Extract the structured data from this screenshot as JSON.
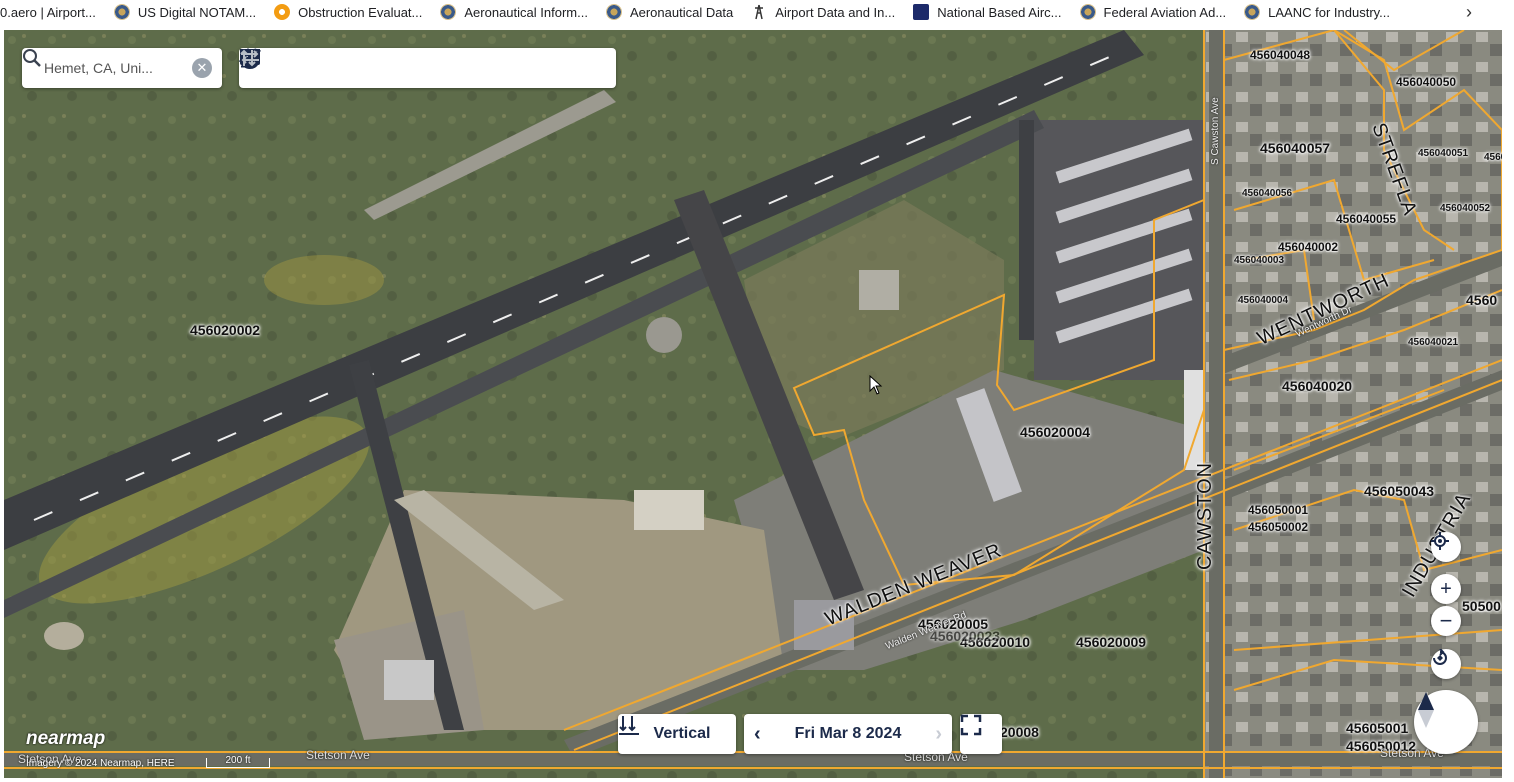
{
  "bookmarks": [
    {
      "label": "0.aero | Airport...",
      "icon": "none"
    },
    {
      "label": "US Digital NOTAM...",
      "icon": "seal"
    },
    {
      "label": "Obstruction Evaluat...",
      "icon": "orange"
    },
    {
      "label": "Aeronautical Inform...",
      "icon": "seal"
    },
    {
      "label": "Aeronautical Data",
      "icon": "seal"
    },
    {
      "label": "Airport Data and In...",
      "icon": "tower"
    },
    {
      "label": "National Based Airc...",
      "icon": "navy"
    },
    {
      "label": "Federal Aviation Ad...",
      "icon": "seal"
    },
    {
      "label": "LAANC for Industry...",
      "icon": "seal"
    }
  ],
  "search": {
    "value": "Hemet, CA, Uni...",
    "clear_label": "✕"
  },
  "tools": [
    "pin-icon",
    "camera-icon",
    "text-icon",
    "polyline-icon",
    "polygon-icon",
    "rectangle-icon",
    "circle-icon",
    "height-icon",
    "swap-icon"
  ],
  "parcels": [
    {
      "id": "p1",
      "label": "456020002"
    },
    {
      "id": "p2",
      "label": "456020004"
    },
    {
      "id": "p3",
      "label": "456040048"
    },
    {
      "id": "p4",
      "label": "456040050"
    },
    {
      "id": "p5",
      "label": "456040057"
    },
    {
      "id": "p6",
      "label": "456040051"
    },
    {
      "id": "p7",
      "label": "456040056"
    },
    {
      "id": "p8",
      "label": "456040055"
    },
    {
      "id": "p9",
      "label": "456040052"
    },
    {
      "id": "p10",
      "label": "456040002"
    },
    {
      "id": "p11",
      "label": "456040003"
    },
    {
      "id": "p12",
      "label": "456040004"
    },
    {
      "id": "p13",
      "label": "456040021"
    },
    {
      "id": "p14",
      "label": "456040020"
    },
    {
      "id": "p15",
      "label": "456050043"
    },
    {
      "id": "p16",
      "label": "456050001"
    },
    {
      "id": "p17",
      "label": "456050002"
    },
    {
      "id": "p18",
      "label": "456020005"
    },
    {
      "id": "p19",
      "label": "456020010"
    },
    {
      "id": "p20",
      "label": "456020009"
    },
    {
      "id": "p21",
      "label": "20008"
    },
    {
      "id": "p22",
      "label": "45605001"
    },
    {
      "id": "p23",
      "label": "4560"
    },
    {
      "id": "p24",
      "label": "4560"
    },
    {
      "id": "p25",
      "label": "50500"
    },
    {
      "id": "p26",
      "label": "456050012"
    },
    {
      "id": "p27",
      "label": "456020023"
    }
  ],
  "streets": [
    {
      "label": "WALDEN WEAVER"
    },
    {
      "label": "CAWSTON"
    },
    {
      "label": "WENTWORTH"
    },
    {
      "label": "STREFLA"
    },
    {
      "label": "INDUSTRIA"
    },
    {
      "label": "Stetson Ave"
    },
    {
      "label": "Stetson Ave"
    },
    {
      "label": "Stetson Ave"
    },
    {
      "label": "Stetson Ave"
    },
    {
      "label": "S Cawston Ave"
    },
    {
      "label": "Walden Weaver Rd"
    },
    {
      "label": "Wentworth Dr"
    }
  ],
  "view": {
    "mode_label": "Vertical",
    "date_label": "Fri Mar 8 2024",
    "zoom_in": "+",
    "zoom_out": "−"
  },
  "brand": {
    "logo": "nearmap",
    "attribution": "Imagery © 2024 Nearmap, HERE",
    "scale": "200 ft"
  },
  "colors": {
    "parcel_line": "#f0a830",
    "toolbar_icon": "#1c2a4a"
  }
}
